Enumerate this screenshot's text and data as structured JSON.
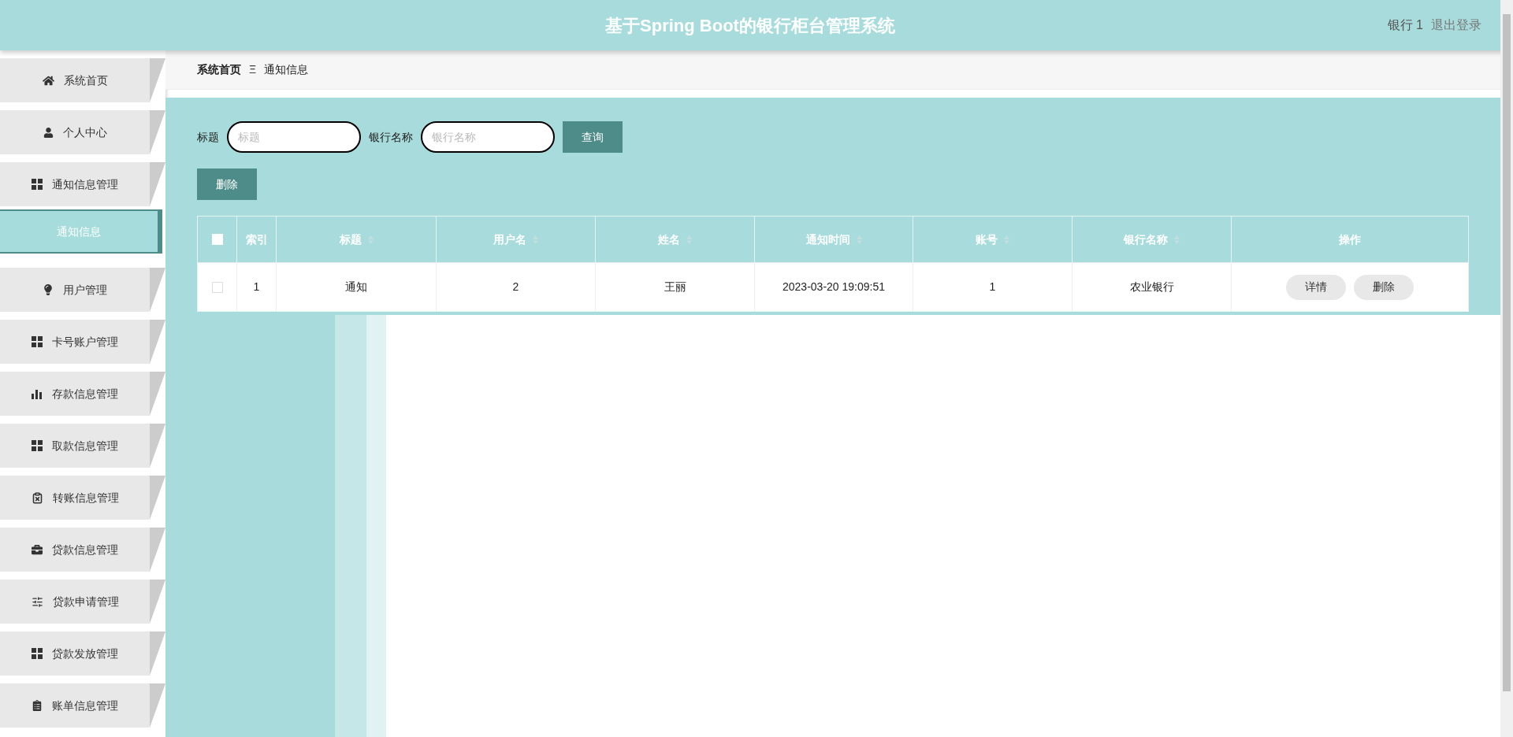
{
  "header": {
    "title": "基于Spring Boot的银行柜台管理系统",
    "user": "银行 1",
    "logout": "退出登录"
  },
  "sidebar": {
    "items": [
      {
        "label": "系统首页",
        "kind": "menu",
        "selected": false
      },
      {
        "label": "个人中心",
        "kind": "menu",
        "selected": false
      },
      {
        "label": "通知信息管理",
        "kind": "menu",
        "selected": false
      },
      {
        "label": "通知信息",
        "kind": "submenu",
        "selected": true
      },
      {
        "label": "用户管理",
        "kind": "menu",
        "selected": false
      },
      {
        "label": "卡号账户管理",
        "kind": "menu",
        "selected": false
      },
      {
        "label": "存款信息管理",
        "kind": "menu",
        "selected": false
      },
      {
        "label": "取款信息管理",
        "kind": "menu",
        "selected": false
      },
      {
        "label": "转账信息管理",
        "kind": "menu",
        "selected": false
      },
      {
        "label": "贷款信息管理",
        "kind": "menu",
        "selected": false
      },
      {
        "label": "贷款申请管理",
        "kind": "menu",
        "selected": false
      },
      {
        "label": "贷款发放管理",
        "kind": "menu",
        "selected": false
      },
      {
        "label": "账单信息管理",
        "kind": "menu",
        "selected": false
      }
    ]
  },
  "breadcrumb": {
    "home": "系统首页",
    "separator": "Ξ",
    "current": "通知信息"
  },
  "search": {
    "fields": [
      {
        "label": "标题",
        "placeholder": "标题"
      },
      {
        "label": "银行名称",
        "placeholder": "银行名称"
      }
    ],
    "button": "查询"
  },
  "delete_button": "删除",
  "table": {
    "select_all": {
      "checked": false
    },
    "columns": [
      {
        "label": "索引",
        "sortable": false
      },
      {
        "label": "标题",
        "sortable": true
      },
      {
        "label": "用户名",
        "sortable": true
      },
      {
        "label": "姓名",
        "sortable": true
      },
      {
        "label": "通知时间",
        "sortable": true
      },
      {
        "label": "账号",
        "sortable": true
      },
      {
        "label": "银行名称",
        "sortable": true
      },
      {
        "label": "操作",
        "sortable": false
      }
    ],
    "rows": [
      {
        "checked": false,
        "cells": [
          "1",
          "通知",
          "2",
          "王丽",
          "2023-03-20 19:09:51",
          "1",
          "农业银行"
        ],
        "actions": [
          "详情",
          "删除"
        ]
      }
    ]
  }
}
